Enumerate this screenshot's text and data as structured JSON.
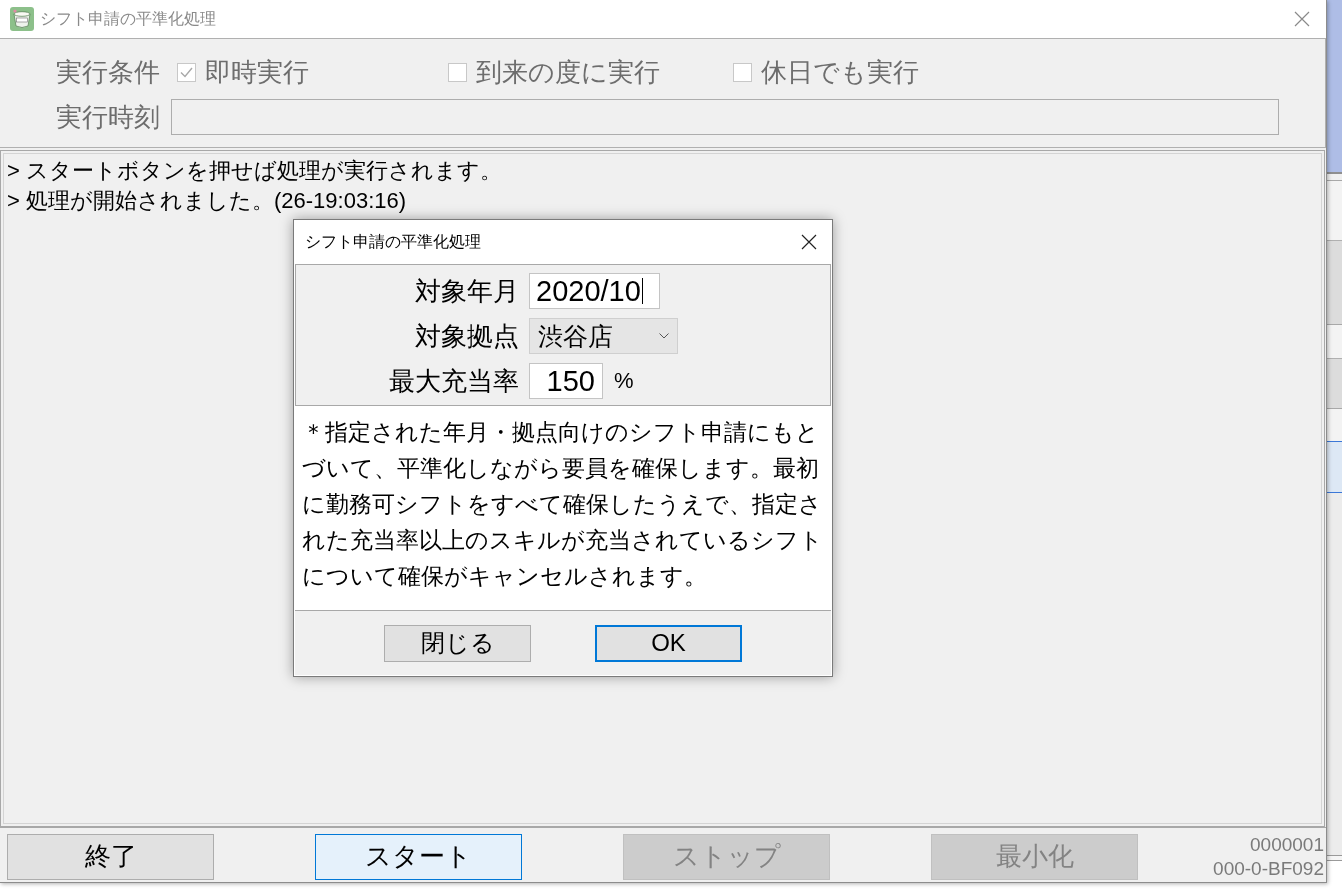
{
  "main_window": {
    "title": "シフト申請の平準化処理",
    "conditions": {
      "label": "実行条件",
      "disabled": true,
      "options": [
        {
          "label": "即時実行",
          "checked": true
        },
        {
          "label": "到来の度に実行",
          "checked": false
        },
        {
          "label": "休日でも実行",
          "checked": false
        }
      ]
    },
    "time_field": {
      "label": "実行時刻",
      "disabled": true
    },
    "log": [
      "> スタートボタンを押せば処理が実行されます。",
      "> 処理が開始されました。(26-19:03:16)"
    ],
    "buttons": [
      {
        "label": "終了",
        "default": false,
        "disabled": false
      },
      {
        "label": "スタート",
        "default": true,
        "disabled": false
      },
      {
        "label": "ストップ",
        "default": false,
        "disabled": true
      },
      {
        "label": "最小化",
        "default": false,
        "disabled": true
      }
    ],
    "status": [
      "0000001",
      "000-0-BF092"
    ]
  },
  "dialog": {
    "title": "シフト申請の平準化処理",
    "fields": [
      {
        "kind": "text",
        "label": "対象年月",
        "value": "2020/10",
        "focused": true
      },
      {
        "kind": "dropdown",
        "label": "対象拠点",
        "value": "渋谷店"
      },
      {
        "kind": "number",
        "label": "最大充当率",
        "value": "150",
        "unit": "%"
      }
    ],
    "description": "＊指定された年月・拠点向けのシフト申請にもとづいて、平準化しながら要員を確保します。最初に勤務可シフトをすべて確保したうえで、指定された充当率以上のスキルが充当されているシフトについて確保がキャンセルされます。",
    "buttons": [
      {
        "label": "閉じる",
        "default": false
      },
      {
        "label": "OK",
        "default": true
      }
    ]
  }
}
